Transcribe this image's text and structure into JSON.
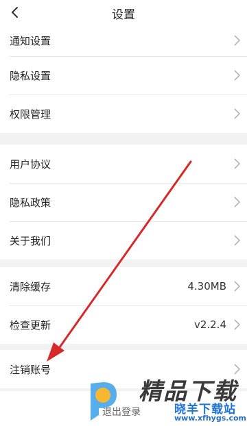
{
  "header": {
    "title": "设置"
  },
  "groups": [
    {
      "items": [
        {
          "label": "通知设置"
        },
        {
          "label": "隐私设置"
        },
        {
          "label": "权限管理"
        }
      ]
    },
    {
      "items": [
        {
          "label": "用户协议"
        },
        {
          "label": "隐私政策"
        },
        {
          "label": "关于我们"
        }
      ]
    },
    {
      "items": [
        {
          "label": "清除缓存",
          "value": "4.30MB"
        },
        {
          "label": "检查更新",
          "value": "v2.2.4"
        }
      ]
    },
    {
      "items": [
        {
          "label": "注销账号"
        }
      ]
    }
  ],
  "footer": {
    "logout_label": "退出登录"
  },
  "watermark": {
    "brand": "精品下载",
    "sub": "晓羊下载站",
    "url": "www.xfhygs.com"
  },
  "icons": {
    "back": "chevron-left-icon",
    "row": "chevron-right-icon"
  },
  "colors": {
    "background": "#f2f2f2",
    "card": "#ffffff",
    "annotation_arrow": "#d42a2a"
  }
}
